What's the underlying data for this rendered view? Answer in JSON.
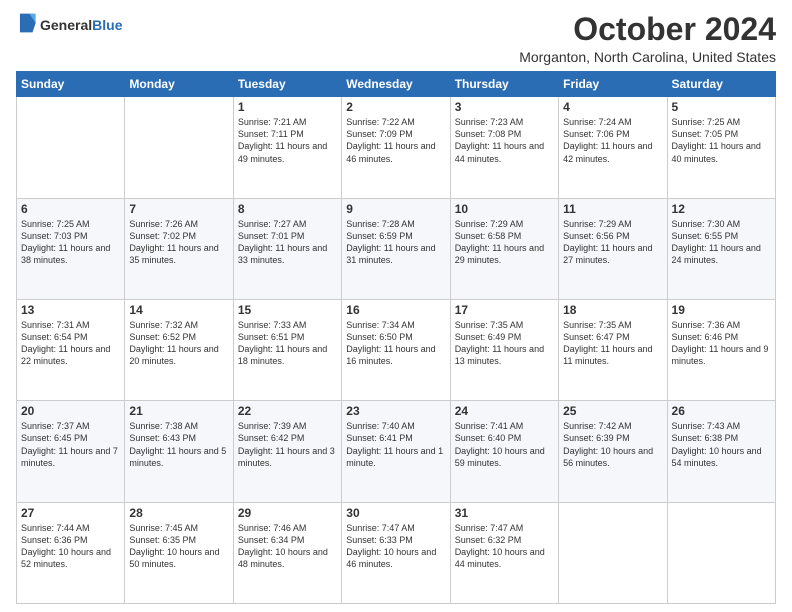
{
  "logo": {
    "general": "General",
    "blue": "Blue"
  },
  "header": {
    "month": "October 2024",
    "location": "Morganton, North Carolina, United States"
  },
  "weekdays": [
    "Sunday",
    "Monday",
    "Tuesday",
    "Wednesday",
    "Thursday",
    "Friday",
    "Saturday"
  ],
  "weeks": [
    [
      {
        "day": "",
        "info": ""
      },
      {
        "day": "",
        "info": ""
      },
      {
        "day": "1",
        "info": "Sunrise: 7:21 AM\nSunset: 7:11 PM\nDaylight: 11 hours and 49 minutes."
      },
      {
        "day": "2",
        "info": "Sunrise: 7:22 AM\nSunset: 7:09 PM\nDaylight: 11 hours and 46 minutes."
      },
      {
        "day": "3",
        "info": "Sunrise: 7:23 AM\nSunset: 7:08 PM\nDaylight: 11 hours and 44 minutes."
      },
      {
        "day": "4",
        "info": "Sunrise: 7:24 AM\nSunset: 7:06 PM\nDaylight: 11 hours and 42 minutes."
      },
      {
        "day": "5",
        "info": "Sunrise: 7:25 AM\nSunset: 7:05 PM\nDaylight: 11 hours and 40 minutes."
      }
    ],
    [
      {
        "day": "6",
        "info": "Sunrise: 7:25 AM\nSunset: 7:03 PM\nDaylight: 11 hours and 38 minutes."
      },
      {
        "day": "7",
        "info": "Sunrise: 7:26 AM\nSunset: 7:02 PM\nDaylight: 11 hours and 35 minutes."
      },
      {
        "day": "8",
        "info": "Sunrise: 7:27 AM\nSunset: 7:01 PM\nDaylight: 11 hours and 33 minutes."
      },
      {
        "day": "9",
        "info": "Sunrise: 7:28 AM\nSunset: 6:59 PM\nDaylight: 11 hours and 31 minutes."
      },
      {
        "day": "10",
        "info": "Sunrise: 7:29 AM\nSunset: 6:58 PM\nDaylight: 11 hours and 29 minutes."
      },
      {
        "day": "11",
        "info": "Sunrise: 7:29 AM\nSunset: 6:56 PM\nDaylight: 11 hours and 27 minutes."
      },
      {
        "day": "12",
        "info": "Sunrise: 7:30 AM\nSunset: 6:55 PM\nDaylight: 11 hours and 24 minutes."
      }
    ],
    [
      {
        "day": "13",
        "info": "Sunrise: 7:31 AM\nSunset: 6:54 PM\nDaylight: 11 hours and 22 minutes."
      },
      {
        "day": "14",
        "info": "Sunrise: 7:32 AM\nSunset: 6:52 PM\nDaylight: 11 hours and 20 minutes."
      },
      {
        "day": "15",
        "info": "Sunrise: 7:33 AM\nSunset: 6:51 PM\nDaylight: 11 hours and 18 minutes."
      },
      {
        "day": "16",
        "info": "Sunrise: 7:34 AM\nSunset: 6:50 PM\nDaylight: 11 hours and 16 minutes."
      },
      {
        "day": "17",
        "info": "Sunrise: 7:35 AM\nSunset: 6:49 PM\nDaylight: 11 hours and 13 minutes."
      },
      {
        "day": "18",
        "info": "Sunrise: 7:35 AM\nSunset: 6:47 PM\nDaylight: 11 hours and 11 minutes."
      },
      {
        "day": "19",
        "info": "Sunrise: 7:36 AM\nSunset: 6:46 PM\nDaylight: 11 hours and 9 minutes."
      }
    ],
    [
      {
        "day": "20",
        "info": "Sunrise: 7:37 AM\nSunset: 6:45 PM\nDaylight: 11 hours and 7 minutes."
      },
      {
        "day": "21",
        "info": "Sunrise: 7:38 AM\nSunset: 6:43 PM\nDaylight: 11 hours and 5 minutes."
      },
      {
        "day": "22",
        "info": "Sunrise: 7:39 AM\nSunset: 6:42 PM\nDaylight: 11 hours and 3 minutes."
      },
      {
        "day": "23",
        "info": "Sunrise: 7:40 AM\nSunset: 6:41 PM\nDaylight: 11 hours and 1 minute."
      },
      {
        "day": "24",
        "info": "Sunrise: 7:41 AM\nSunset: 6:40 PM\nDaylight: 10 hours and 59 minutes."
      },
      {
        "day": "25",
        "info": "Sunrise: 7:42 AM\nSunset: 6:39 PM\nDaylight: 10 hours and 56 minutes."
      },
      {
        "day": "26",
        "info": "Sunrise: 7:43 AM\nSunset: 6:38 PM\nDaylight: 10 hours and 54 minutes."
      }
    ],
    [
      {
        "day": "27",
        "info": "Sunrise: 7:44 AM\nSunset: 6:36 PM\nDaylight: 10 hours and 52 minutes."
      },
      {
        "day": "28",
        "info": "Sunrise: 7:45 AM\nSunset: 6:35 PM\nDaylight: 10 hours and 50 minutes."
      },
      {
        "day": "29",
        "info": "Sunrise: 7:46 AM\nSunset: 6:34 PM\nDaylight: 10 hours and 48 minutes."
      },
      {
        "day": "30",
        "info": "Sunrise: 7:47 AM\nSunset: 6:33 PM\nDaylight: 10 hours and 46 minutes."
      },
      {
        "day": "31",
        "info": "Sunrise: 7:47 AM\nSunset: 6:32 PM\nDaylight: 10 hours and 44 minutes."
      },
      {
        "day": "",
        "info": ""
      },
      {
        "day": "",
        "info": ""
      }
    ]
  ]
}
